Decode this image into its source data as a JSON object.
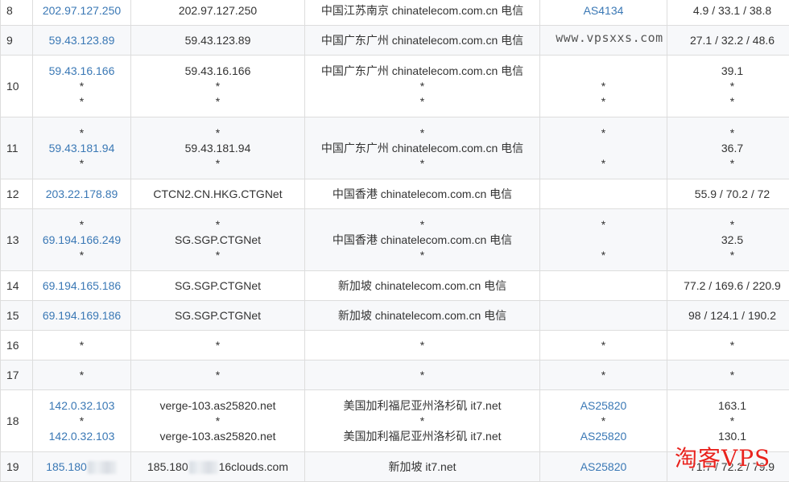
{
  "watermark": {
    "text": "www.vpsxxs.com",
    "logo": "淘客VPS"
  },
  "rows": [
    {
      "hop": "8",
      "ip": [
        "202.97.127.250"
      ],
      "host": [
        "202.97.127.250"
      ],
      "loc": [
        "中国江苏南京 chinatelecom.com.cn 电信"
      ],
      "as": [
        "AS4134"
      ],
      "lat": [
        "4.9 / 33.1 / 38.8"
      ]
    },
    {
      "hop": "9",
      "ip": [
        "59.43.123.89"
      ],
      "host": [
        "59.43.123.89"
      ],
      "loc": [
        "中国广东广州 chinatelecom.com.cn 电信"
      ],
      "as": [
        ""
      ],
      "lat": [
        "27.1 / 32.2 / 48.6"
      ]
    },
    {
      "hop": "10",
      "ip": [
        "59.43.16.166",
        "*",
        "*"
      ],
      "host": [
        "59.43.16.166",
        "*",
        "*"
      ],
      "loc": [
        "中国广东广州 chinatelecom.com.cn 电信",
        "*",
        "*"
      ],
      "as": [
        "",
        "*",
        "*"
      ],
      "lat": [
        "39.1",
        "*",
        "*"
      ]
    },
    {
      "hop": "11",
      "ip": [
        "*",
        "59.43.181.94",
        "*"
      ],
      "host": [
        "*",
        "59.43.181.94",
        "*"
      ],
      "loc": [
        "*",
        "中国广东广州 chinatelecom.com.cn 电信",
        "*"
      ],
      "as": [
        "*",
        "",
        "*"
      ],
      "lat": [
        "*",
        "36.7",
        "*"
      ]
    },
    {
      "hop": "12",
      "ip": [
        "203.22.178.89"
      ],
      "host": [
        "CTCN2.CN.HKG.CTGNet"
      ],
      "loc": [
        "中国香港 chinatelecom.com.cn 电信"
      ],
      "as": [
        ""
      ],
      "lat": [
        "55.9 / 70.2 / 72"
      ]
    },
    {
      "hop": "13",
      "ip": [
        "*",
        "69.194.166.249",
        "*"
      ],
      "host": [
        "*",
        "SG.SGP.CTGNet",
        "*"
      ],
      "loc": [
        "*",
        "中国香港 chinatelecom.com.cn 电信",
        "*"
      ],
      "as": [
        "*",
        "",
        "*"
      ],
      "lat": [
        "*",
        "32.5",
        "*"
      ]
    },
    {
      "hop": "14",
      "ip": [
        "69.194.165.186"
      ],
      "host": [
        "SG.SGP.CTGNet"
      ],
      "loc": [
        "新加坡 chinatelecom.com.cn 电信"
      ],
      "as": [
        ""
      ],
      "lat": [
        "77.2 / 169.6 / 220.9"
      ]
    },
    {
      "hop": "15",
      "ip": [
        "69.194.169.186"
      ],
      "host": [
        "SG.SGP.CTGNet"
      ],
      "loc": [
        "新加坡 chinatelecom.com.cn 电信"
      ],
      "as": [
        ""
      ],
      "lat": [
        "98 / 124.1 / 190.2"
      ]
    },
    {
      "hop": "16",
      "ip": [
        "*"
      ],
      "host": [
        "*"
      ],
      "loc": [
        "*"
      ],
      "as": [
        "*"
      ],
      "lat": [
        "*"
      ]
    },
    {
      "hop": "17",
      "ip": [
        "*"
      ],
      "host": [
        "*"
      ],
      "loc": [
        "*"
      ],
      "as": [
        "*"
      ],
      "lat": [
        "*"
      ]
    },
    {
      "hop": "18",
      "ip": [
        "142.0.32.103",
        "*",
        "142.0.32.103"
      ],
      "host": [
        "verge-103.as25820.net",
        "*",
        "verge-103.as25820.net"
      ],
      "loc": [
        "美国加利福尼亚州洛杉矶 it7.net",
        "*",
        "美国加利福尼亚州洛杉矶 it7.net"
      ],
      "as": [
        "AS25820",
        "*",
        "AS25820"
      ],
      "lat": [
        "163.1",
        "*",
        "130.1"
      ]
    },
    {
      "hop": "19",
      "ip": [
        "185.180"
      ],
      "host": [
        "185.180",
        "16clouds.com"
      ],
      "loc": [
        "新加坡 it7.net"
      ],
      "as": [
        "AS25820"
      ],
      "lat": [
        "71.7 / 72.2 / 79.9"
      ]
    }
  ]
}
